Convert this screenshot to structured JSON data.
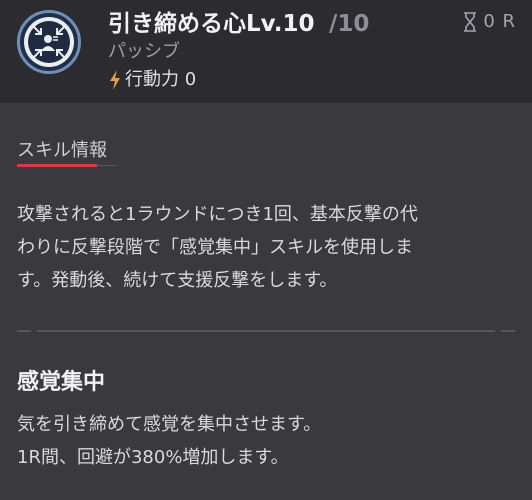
{
  "skill": {
    "name_level": "引き締める心Lv.10",
    "max_level": "/10",
    "type": "パッシブ",
    "action_power": "行動力 0",
    "cooldown": "0 R",
    "icon": "focus-person-icon"
  },
  "info": {
    "heading": "スキル情報",
    "description_lines": [
      "攻撃されると1ラウンドにつき1回、基本反撃の代",
      "わりに反撃段階で「感覚集中」スキルを使用しま",
      "す。発動後、続けて支援反撃をします。"
    ]
  },
  "effect": {
    "title": "感覚集中",
    "lines": [
      "気を引き締めて感覚を集中させます。",
      "1R間、回避が380%増加します。"
    ]
  },
  "colors": {
    "accent_underline": "#d33d4a",
    "icon_ring": "#6f8fb8",
    "header_bg": "#2c2c30",
    "panel_bg": "#3a3a3e"
  }
}
